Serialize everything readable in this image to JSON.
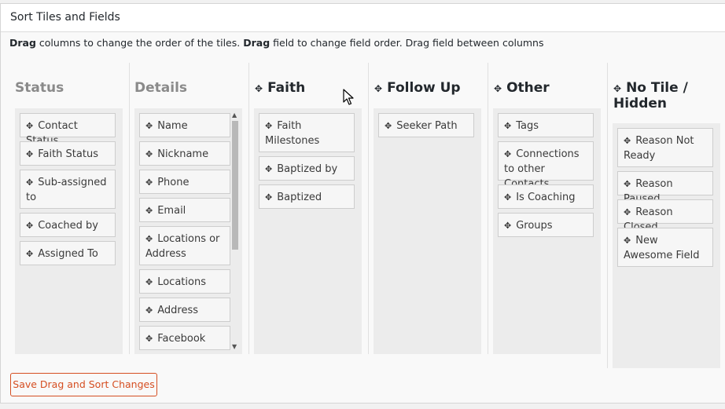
{
  "panel": {
    "title": "Sort Tiles and Fields"
  },
  "instructions": {
    "part1_bold": "Drag",
    "part1": " columns to change the order of the tiles. ",
    "part2_bold": "Drag",
    "part2": " field to change field order. Drag field between columns"
  },
  "move_glyph": "✥",
  "columns": [
    {
      "title": "Status",
      "items": [
        "Contact Status",
        "Faith Status",
        "Sub-assigned to",
        "Coached by",
        "Assigned To"
      ]
    },
    {
      "title": "Details",
      "items": [
        "Name",
        "Nickname",
        "Phone",
        "Email",
        "Locations or Address",
        "Locations",
        "Address",
        "Facebook"
      ]
    },
    {
      "title": "Faith",
      "items": [
        "Faith Milestones",
        "Baptized by",
        "Baptized"
      ]
    },
    {
      "title": "Follow Up",
      "items": [
        "Seeker Path"
      ]
    },
    {
      "title": "Other",
      "items": [
        "Tags",
        "Connections to other Contacts",
        "Is Coaching",
        "Groups"
      ]
    },
    {
      "title": "No Tile / Hidden",
      "items": [
        "Reason Not Ready",
        "Reason Paused",
        "Reason Closed",
        "New Awesome Field"
      ]
    }
  ],
  "save_button": "Save Drag and Sort Changes"
}
